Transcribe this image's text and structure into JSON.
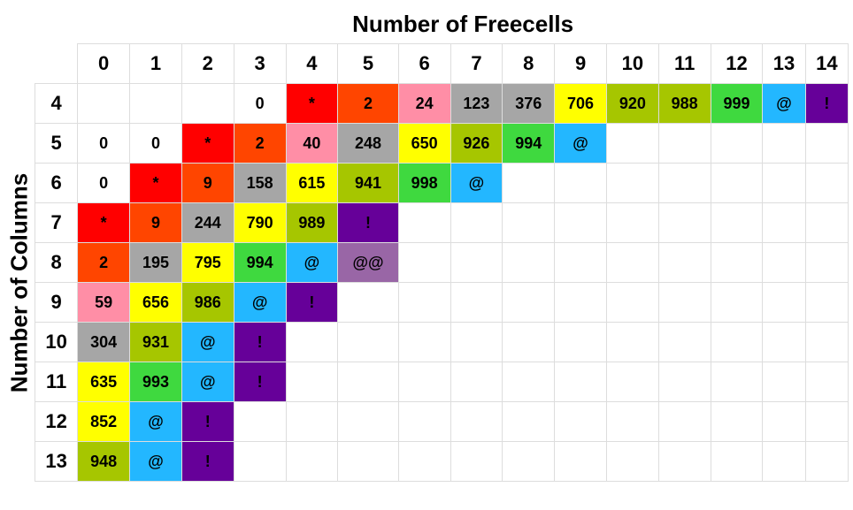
{
  "title_top": "Number of Freecells",
  "title_side": "Number of Columns",
  "col_headers": [
    "0",
    "1",
    "2",
    "3",
    "4",
    "5",
    "6",
    "7",
    "8",
    "9",
    "10",
    "11",
    "12",
    "13",
    "14"
  ],
  "row_headers": [
    "4",
    "5",
    "6",
    "7",
    "8",
    "9",
    "10",
    "11",
    "12",
    "13"
  ],
  "chart_data": {
    "type": "heatmap",
    "title": "",
    "xlabel": "Number of Freecells",
    "ylabel": "Number of Columns",
    "x": [
      0,
      1,
      2,
      3,
      4,
      5,
      6,
      7,
      8,
      9,
      10,
      11,
      12,
      13,
      14
    ],
    "y": [
      4,
      5,
      6,
      7,
      8,
      9,
      10,
      11,
      12,
      13
    ],
    "rows": [
      {
        "y": 4,
        "cells": [
          {
            "x": 0,
            "v": "",
            "color": ""
          },
          {
            "x": 1,
            "v": "",
            "color": ""
          },
          {
            "x": 2,
            "v": "",
            "color": ""
          },
          {
            "x": 3,
            "v": "0",
            "color": "white"
          },
          {
            "x": 4,
            "v": "*",
            "color": "red"
          },
          {
            "x": 5,
            "v": "2",
            "color": "orangered"
          },
          {
            "x": 6,
            "v": "24",
            "color": "salmon"
          },
          {
            "x": 7,
            "v": "123",
            "color": "gray"
          },
          {
            "x": 8,
            "v": "376",
            "color": "gray"
          },
          {
            "x": 9,
            "v": "706",
            "color": "yellow"
          },
          {
            "x": 10,
            "v": "920",
            "color": "olive"
          },
          {
            "x": 11,
            "v": "988",
            "color": "olive"
          },
          {
            "x": 12,
            "v": "999",
            "color": "green"
          },
          {
            "x": 13,
            "v": "@",
            "color": "cyan"
          },
          {
            "x": 14,
            "v": "!",
            "color": "purple"
          }
        ]
      },
      {
        "y": 5,
        "cells": [
          {
            "x": 0,
            "v": "0",
            "color": "white"
          },
          {
            "x": 1,
            "v": "0",
            "color": "white"
          },
          {
            "x": 2,
            "v": "*",
            "color": "red"
          },
          {
            "x": 3,
            "v": "2",
            "color": "orangered"
          },
          {
            "x": 4,
            "v": "40",
            "color": "salmon"
          },
          {
            "x": 5,
            "v": "248",
            "color": "gray"
          },
          {
            "x": 6,
            "v": "650",
            "color": "yellow"
          },
          {
            "x": 7,
            "v": "926",
            "color": "olive"
          },
          {
            "x": 8,
            "v": "994",
            "color": "green"
          },
          {
            "x": 9,
            "v": "@",
            "color": "cyan"
          },
          {
            "x": 10,
            "v": "",
            "color": ""
          },
          {
            "x": 11,
            "v": "",
            "color": ""
          },
          {
            "x": 12,
            "v": "",
            "color": ""
          },
          {
            "x": 13,
            "v": "",
            "color": ""
          },
          {
            "x": 14,
            "v": "",
            "color": ""
          }
        ]
      },
      {
        "y": 6,
        "cells": [
          {
            "x": 0,
            "v": "0",
            "color": "white"
          },
          {
            "x": 1,
            "v": "*",
            "color": "red"
          },
          {
            "x": 2,
            "v": "9",
            "color": "orangered"
          },
          {
            "x": 3,
            "v": "158",
            "color": "gray"
          },
          {
            "x": 4,
            "v": "615",
            "color": "yellow"
          },
          {
            "x": 5,
            "v": "941",
            "color": "olive"
          },
          {
            "x": 6,
            "v": "998",
            "color": "green"
          },
          {
            "x": 7,
            "v": "@",
            "color": "cyan"
          },
          {
            "x": 8,
            "v": "",
            "color": ""
          },
          {
            "x": 9,
            "v": "",
            "color": ""
          },
          {
            "x": 10,
            "v": "",
            "color": ""
          },
          {
            "x": 11,
            "v": "",
            "color": ""
          },
          {
            "x": 12,
            "v": "",
            "color": ""
          },
          {
            "x": 13,
            "v": "",
            "color": ""
          },
          {
            "x": 14,
            "v": "",
            "color": ""
          }
        ]
      },
      {
        "y": 7,
        "cells": [
          {
            "x": 0,
            "v": "*",
            "color": "red"
          },
          {
            "x": 1,
            "v": "9",
            "color": "orangered"
          },
          {
            "x": 2,
            "v": "244",
            "color": "gray"
          },
          {
            "x": 3,
            "v": "790",
            "color": "yellow"
          },
          {
            "x": 4,
            "v": "989",
            "color": "olive"
          },
          {
            "x": 5,
            "v": "!",
            "color": "purple"
          },
          {
            "x": 6,
            "v": "",
            "color": ""
          },
          {
            "x": 7,
            "v": "",
            "color": ""
          },
          {
            "x": 8,
            "v": "",
            "color": ""
          },
          {
            "x": 9,
            "v": "",
            "color": ""
          },
          {
            "x": 10,
            "v": "",
            "color": ""
          },
          {
            "x": 11,
            "v": "",
            "color": ""
          },
          {
            "x": 12,
            "v": "",
            "color": ""
          },
          {
            "x": 13,
            "v": "",
            "color": ""
          },
          {
            "x": 14,
            "v": "",
            "color": ""
          }
        ]
      },
      {
        "y": 8,
        "cells": [
          {
            "x": 0,
            "v": "2",
            "color": "orangered"
          },
          {
            "x": 1,
            "v": "195",
            "color": "gray"
          },
          {
            "x": 2,
            "v": "795",
            "color": "yellow"
          },
          {
            "x": 3,
            "v": "994",
            "color": "green"
          },
          {
            "x": 4,
            "v": "@",
            "color": "cyan"
          },
          {
            "x": 5,
            "v": "@@",
            "color": "medpurple"
          },
          {
            "x": 6,
            "v": "",
            "color": ""
          },
          {
            "x": 7,
            "v": "",
            "color": ""
          },
          {
            "x": 8,
            "v": "",
            "color": ""
          },
          {
            "x": 9,
            "v": "",
            "color": ""
          },
          {
            "x": 10,
            "v": "",
            "color": ""
          },
          {
            "x": 11,
            "v": "",
            "color": ""
          },
          {
            "x": 12,
            "v": "",
            "color": ""
          },
          {
            "x": 13,
            "v": "",
            "color": ""
          },
          {
            "x": 14,
            "v": "",
            "color": ""
          }
        ]
      },
      {
        "y": 9,
        "cells": [
          {
            "x": 0,
            "v": "59",
            "color": "salmon"
          },
          {
            "x": 1,
            "v": "656",
            "color": "yellow"
          },
          {
            "x": 2,
            "v": "986",
            "color": "olive"
          },
          {
            "x": 3,
            "v": "@",
            "color": "cyan"
          },
          {
            "x": 4,
            "v": "!",
            "color": "purple"
          },
          {
            "x": 5,
            "v": "",
            "color": ""
          },
          {
            "x": 6,
            "v": "",
            "color": ""
          },
          {
            "x": 7,
            "v": "",
            "color": ""
          },
          {
            "x": 8,
            "v": "",
            "color": ""
          },
          {
            "x": 9,
            "v": "",
            "color": ""
          },
          {
            "x": 10,
            "v": "",
            "color": ""
          },
          {
            "x": 11,
            "v": "",
            "color": ""
          },
          {
            "x": 12,
            "v": "",
            "color": ""
          },
          {
            "x": 13,
            "v": "",
            "color": ""
          },
          {
            "x": 14,
            "v": "",
            "color": ""
          }
        ]
      },
      {
        "y": 10,
        "cells": [
          {
            "x": 0,
            "v": "304",
            "color": "gray"
          },
          {
            "x": 1,
            "v": "931",
            "color": "olive"
          },
          {
            "x": 2,
            "v": "@",
            "color": "cyan"
          },
          {
            "x": 3,
            "v": "!",
            "color": "purple"
          },
          {
            "x": 4,
            "v": "",
            "color": ""
          },
          {
            "x": 5,
            "v": "",
            "color": ""
          },
          {
            "x": 6,
            "v": "",
            "color": ""
          },
          {
            "x": 7,
            "v": "",
            "color": ""
          },
          {
            "x": 8,
            "v": "",
            "color": ""
          },
          {
            "x": 9,
            "v": "",
            "color": ""
          },
          {
            "x": 10,
            "v": "",
            "color": ""
          },
          {
            "x": 11,
            "v": "",
            "color": ""
          },
          {
            "x": 12,
            "v": "",
            "color": ""
          },
          {
            "x": 13,
            "v": "",
            "color": ""
          },
          {
            "x": 14,
            "v": "",
            "color": ""
          }
        ]
      },
      {
        "y": 11,
        "cells": [
          {
            "x": 0,
            "v": "635",
            "color": "yellow"
          },
          {
            "x": 1,
            "v": "993",
            "color": "green"
          },
          {
            "x": 2,
            "v": "@",
            "color": "cyan"
          },
          {
            "x": 3,
            "v": "!",
            "color": "purple"
          },
          {
            "x": 4,
            "v": "",
            "color": ""
          },
          {
            "x": 5,
            "v": "",
            "color": ""
          },
          {
            "x": 6,
            "v": "",
            "color": ""
          },
          {
            "x": 7,
            "v": "",
            "color": ""
          },
          {
            "x": 8,
            "v": "",
            "color": ""
          },
          {
            "x": 9,
            "v": "",
            "color": ""
          },
          {
            "x": 10,
            "v": "",
            "color": ""
          },
          {
            "x": 11,
            "v": "",
            "color": ""
          },
          {
            "x": 12,
            "v": "",
            "color": ""
          },
          {
            "x": 13,
            "v": "",
            "color": ""
          },
          {
            "x": 14,
            "v": "",
            "color": ""
          }
        ]
      },
      {
        "y": 12,
        "cells": [
          {
            "x": 0,
            "v": "852",
            "color": "yellow"
          },
          {
            "x": 1,
            "v": "@",
            "color": "cyan"
          },
          {
            "x": 2,
            "v": "!",
            "color": "purple"
          },
          {
            "x": 3,
            "v": "",
            "color": ""
          },
          {
            "x": 4,
            "v": "",
            "color": ""
          },
          {
            "x": 5,
            "v": "",
            "color": ""
          },
          {
            "x": 6,
            "v": "",
            "color": ""
          },
          {
            "x": 7,
            "v": "",
            "color": ""
          },
          {
            "x": 8,
            "v": "",
            "color": ""
          },
          {
            "x": 9,
            "v": "",
            "color": ""
          },
          {
            "x": 10,
            "v": "",
            "color": ""
          },
          {
            "x": 11,
            "v": "",
            "color": ""
          },
          {
            "x": 12,
            "v": "",
            "color": ""
          },
          {
            "x": 13,
            "v": "",
            "color": ""
          },
          {
            "x": 14,
            "v": "",
            "color": ""
          }
        ]
      },
      {
        "y": 13,
        "cells": [
          {
            "x": 0,
            "v": "948",
            "color": "olive"
          },
          {
            "x": 1,
            "v": "@",
            "color": "cyan"
          },
          {
            "x": 2,
            "v": "!",
            "color": "purple"
          },
          {
            "x": 3,
            "v": "",
            "color": ""
          },
          {
            "x": 4,
            "v": "",
            "color": ""
          },
          {
            "x": 5,
            "v": "",
            "color": ""
          },
          {
            "x": 6,
            "v": "",
            "color": ""
          },
          {
            "x": 7,
            "v": "",
            "color": ""
          },
          {
            "x": 8,
            "v": "",
            "color": ""
          },
          {
            "x": 9,
            "v": "",
            "color": ""
          },
          {
            "x": 10,
            "v": "",
            "color": ""
          },
          {
            "x": 11,
            "v": "",
            "color": ""
          },
          {
            "x": 12,
            "v": "",
            "color": ""
          },
          {
            "x": 13,
            "v": "",
            "color": ""
          },
          {
            "x": 14,
            "v": "",
            "color": ""
          }
        ]
      }
    ]
  }
}
